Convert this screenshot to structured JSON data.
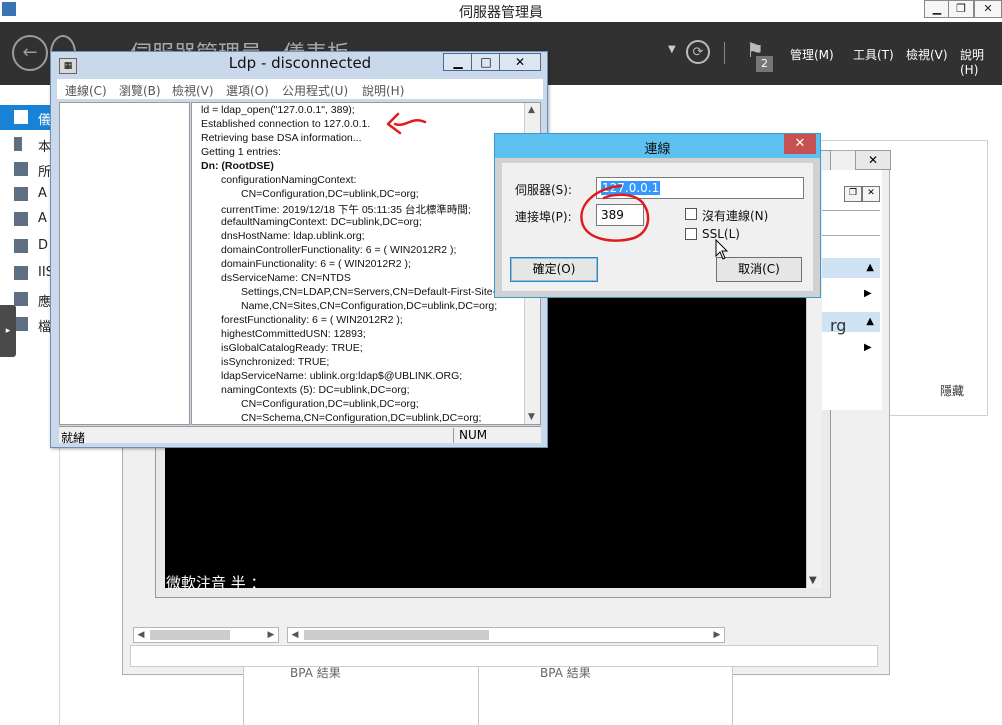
{
  "server_manager": {
    "title": "伺服器管理員",
    "breadcrumb": "伺服器管理員 · 儀表板",
    "menu": [
      "管理(M)",
      "工具(T)",
      "檢視(V)",
      "說明(H)"
    ],
    "flag_count": "2",
    "nav_items": [
      "儀",
      "本",
      "所",
      "A",
      "A",
      "D",
      "IIS",
      "應",
      "檔"
    ],
    "side_tab_glyph": "▸"
  },
  "background": {
    "bottom_labels": [
      "BPA 結果",
      "BPA 結果"
    ],
    "hide_label": "隱藏",
    "right_fragment": "rg",
    "ime_status": "微軟注音 半 ："
  },
  "ldp": {
    "title": "Ldp - disconnected",
    "menu": [
      "連線(C)",
      "瀏覽(B)",
      "檢視(V)",
      "選項(O)",
      "公用程式(U)",
      "說明(H)"
    ],
    "output_lines": [
      {
        "text": "ld = ldap_open(\"127.0.0.1\", 389);",
        "indent": 0,
        "bold": false
      },
      {
        "text": "Established connection to 127.0.0.1.",
        "indent": 0,
        "bold": false
      },
      {
        "text": "Retrieving base DSA information...",
        "indent": 0,
        "bold": false
      },
      {
        "text": "Getting 1 entries:",
        "indent": 0,
        "bold": false
      },
      {
        "text": "Dn: (RootDSE)",
        "indent": 0,
        "bold": true
      },
      {
        "text": "configurationNamingContext:",
        "indent": 1,
        "bold": false
      },
      {
        "text": "CN=Configuration,DC=ublink,DC=org;",
        "indent": 2,
        "bold": false
      },
      {
        "text": "currentTime: 2019/12/18 下午 05:11:35 台北標準時間;",
        "indent": 1,
        "bold": false
      },
      {
        "text": "defaultNamingContext: DC=ublink,DC=org;",
        "indent": 1,
        "bold": false
      },
      {
        "text": "dnsHostName: ldap.ublink.org;",
        "indent": 1,
        "bold": false
      },
      {
        "text": "domainControllerFunctionality: 6 = ( WIN2012R2 );",
        "indent": 1,
        "bold": false
      },
      {
        "text": "domainFunctionality: 6 = ( WIN2012R2 );",
        "indent": 1,
        "bold": false
      },
      {
        "text": "dsServiceName: CN=NTDS",
        "indent": 1,
        "bold": false
      },
      {
        "text": "Settings,CN=LDAP,CN=Servers,CN=Default-First-Site-",
        "indent": 2,
        "bold": false
      },
      {
        "text": "Name,CN=Sites,CN=Configuration,DC=ublink,DC=org;",
        "indent": 2,
        "bold": false
      },
      {
        "text": "forestFunctionality: 6 = ( WIN2012R2 );",
        "indent": 1,
        "bold": false
      },
      {
        "text": "highestCommittedUSN: 12893;",
        "indent": 1,
        "bold": false
      },
      {
        "text": "isGlobalCatalogReady: TRUE;",
        "indent": 1,
        "bold": false
      },
      {
        "text": "isSynchronized: TRUE;",
        "indent": 1,
        "bold": false
      },
      {
        "text": "ldapServiceName: ublink.org:ldap$@UBLINK.ORG;",
        "indent": 1,
        "bold": false
      },
      {
        "text": "namingContexts (5): DC=ublink,DC=org;",
        "indent": 1,
        "bold": false
      },
      {
        "text": "CN=Configuration,DC=ublink,DC=org;",
        "indent": 2,
        "bold": false
      },
      {
        "text": "CN=Schema,CN=Configuration,DC=ublink,DC=org;",
        "indent": 2,
        "bold": false
      }
    ],
    "status_left": "就緒",
    "status_num": "NUM"
  },
  "connect_dialog": {
    "title": "連線",
    "server_label": "伺服器(S):",
    "server_value": "127.0.0.1",
    "port_label": "連接埠(P):",
    "port_value": "389",
    "connectionless_label": "沒有連線(N)",
    "ssl_label": "SSL(L)",
    "ok_label": "確定(O)",
    "cancel_label": "取消(C)"
  }
}
